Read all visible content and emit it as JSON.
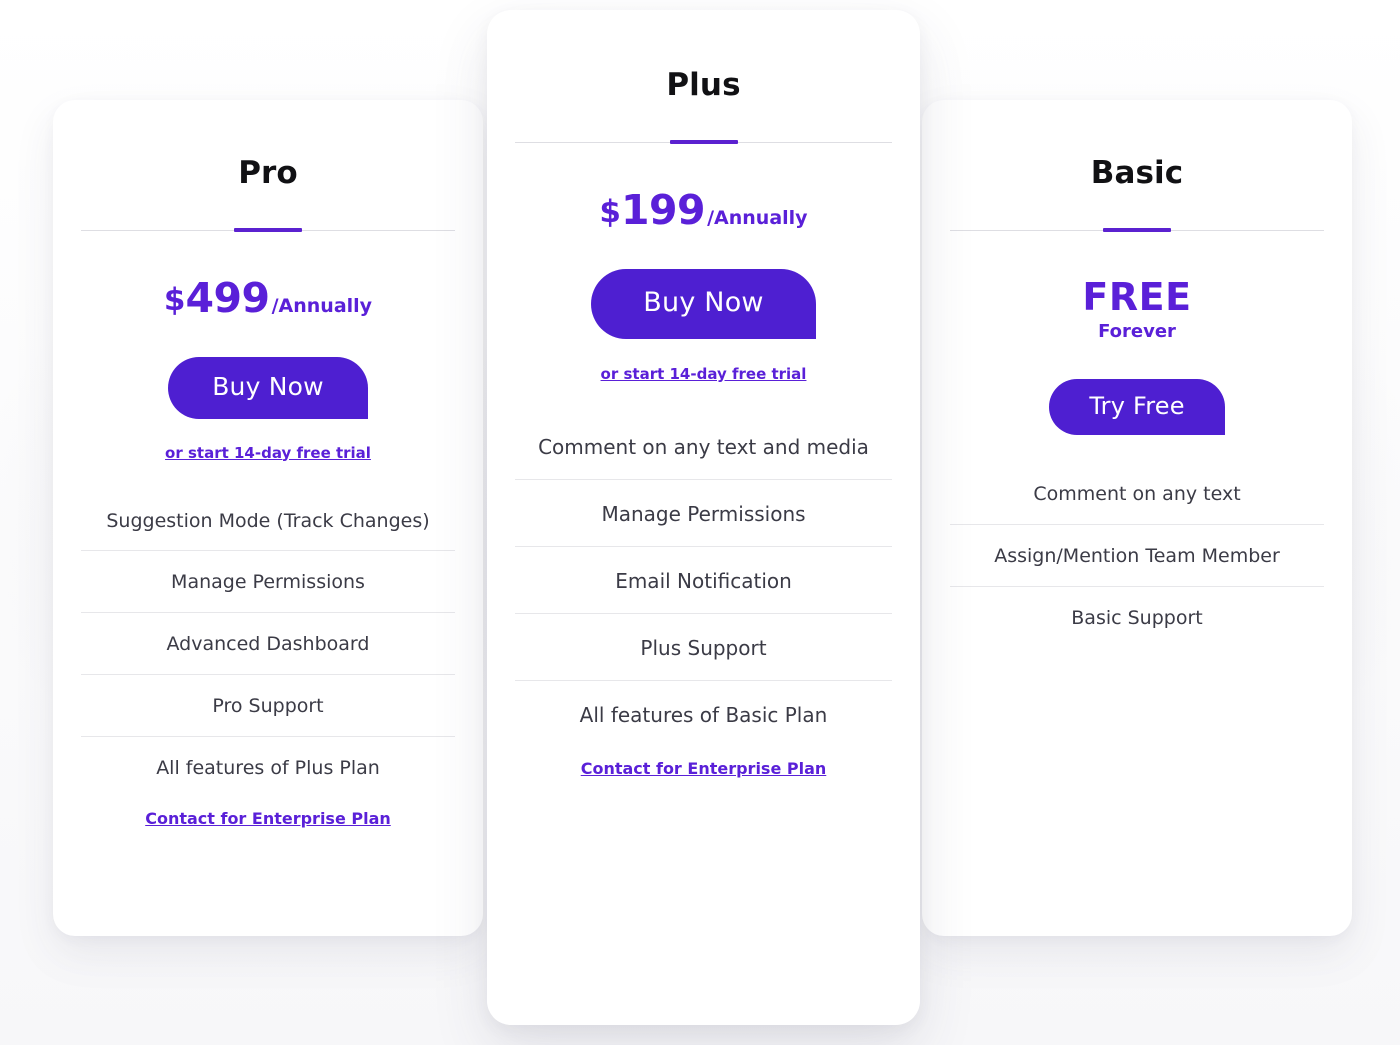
{
  "theme": {
    "accent": "#5a20d8",
    "button": "#4e1fd1",
    "title_color": "#111114",
    "feature_color": "#3b3b46",
    "divider": "#e7e7ea",
    "card_background": "#ffffff",
    "page_background": "#fdfdfe"
  },
  "plans": [
    {
      "id": "pro",
      "title": "Pro",
      "price_currency": "$",
      "price_amount": "499",
      "price_period": "/Annually",
      "cta_label": "Buy Now",
      "trial_label": "or start 14-day free trial",
      "features": [
        "Suggestion Mode (Track Changes)",
        "Manage Permissions",
        "Advanced Dashboard",
        "Pro Support",
        "All features of Plus Plan"
      ],
      "enterprise_label": "Contact for Enterprise Plan"
    },
    {
      "id": "plus",
      "title": "Plus",
      "price_currency": "$",
      "price_amount": "199",
      "price_period": "/Annually",
      "cta_label": "Buy Now",
      "trial_label": "or start 14-day free trial",
      "features": [
        "Comment on any text and media",
        "Manage Permissions",
        "Email Notification",
        "Plus Support",
        "All features of Basic Plan"
      ],
      "enterprise_label": "Contact for Enterprise Plan"
    },
    {
      "id": "basic",
      "title": "Basic",
      "price_free": "FREE",
      "price_free_sub": "Forever",
      "cta_label": "Try Free",
      "features": [
        "Comment on any text",
        "Assign/Mention Team Member",
        "Basic Support"
      ]
    }
  ]
}
